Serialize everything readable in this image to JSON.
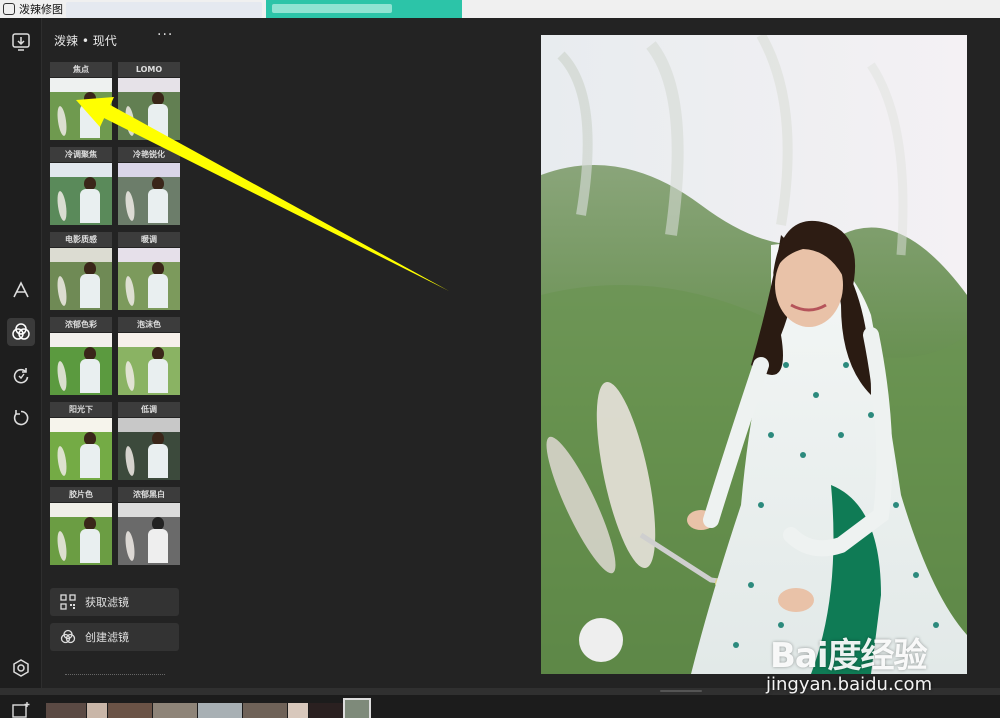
{
  "window": {
    "title": "泼辣修图"
  },
  "panel": {
    "title": "泼辣 • 现代",
    "more": "···",
    "filters": [
      {
        "label": "焦点"
      },
      {
        "label": "LOMO"
      },
      {
        "label": "冷调聚焦"
      },
      {
        "label": "冷艳锐化"
      },
      {
        "label": "电影质感"
      },
      {
        "label": "暖调"
      },
      {
        "label": "浓郁色彩"
      },
      {
        "label": "泡沫色"
      },
      {
        "label": "阳光下"
      },
      {
        "label": "低调"
      },
      {
        "label": "胶片色"
      },
      {
        "label": "浓郁黑白"
      }
    ],
    "get_filters": "获取滤镜",
    "create_filter": "创建滤镜"
  },
  "toolbar": {
    "items": [
      {
        "icon": "download-icon"
      },
      {
        "icon": "text-icon"
      },
      {
        "icon": "filter-icon"
      },
      {
        "icon": "refresh-icon"
      },
      {
        "icon": "undo-icon"
      },
      {
        "icon": "settings-icon"
      }
    ]
  },
  "colors": {
    "arrow": "#ffff00",
    "accent": "#3c3c3c"
  },
  "watermark": {
    "logo": "Bai度经验",
    "url": "jingyan.baidu.com"
  }
}
